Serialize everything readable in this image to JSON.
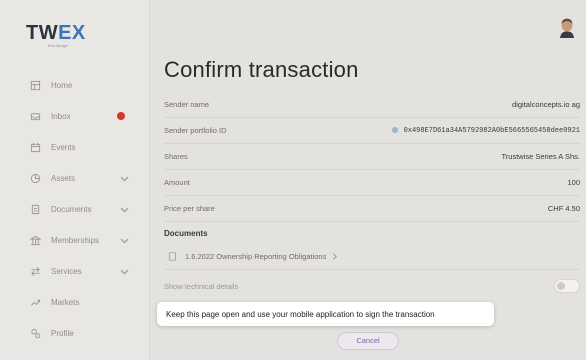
{
  "brand": {
    "logo_main": "TW",
    "logo_accent": "EX",
    "logo_sub": "Exchange"
  },
  "sidebar": {
    "items": [
      {
        "label": "Home",
        "icon": "home-icon"
      },
      {
        "label": "Inbox",
        "icon": "inbox-icon",
        "badge": true
      },
      {
        "label": "Events",
        "icon": "calendar-icon"
      },
      {
        "label": "Assets",
        "icon": "assets-icon",
        "chevron": true
      },
      {
        "label": "Documents",
        "icon": "documents-icon",
        "chevron": true
      },
      {
        "label": "Memberships",
        "icon": "memberships-icon",
        "chevron": true
      },
      {
        "label": "Services",
        "icon": "services-icon",
        "chevron": true
      },
      {
        "label": "Markets",
        "icon": "markets-icon"
      },
      {
        "label": "Profile",
        "icon": "profile-icon"
      }
    ]
  },
  "main": {
    "title": "Confirm transaction",
    "fields": [
      {
        "label": "Sender name",
        "value": "digitalconcepts.io ag"
      },
      {
        "label": "Sender portfolio ID",
        "value": "0x498E7D61a34A5792982A0bE5665565458dee0921"
      },
      {
        "label": "Shares",
        "value": "Trustwise Series A Shs."
      },
      {
        "label": "Amount",
        "value": "100"
      },
      {
        "label": "Price per share",
        "value": "CHF 4.50"
      }
    ],
    "documents_title": "Documents",
    "document_item": "1.6.2022 Ownership Reporting Obligations",
    "technical_label": "Show technical details",
    "toast": "Keep this page open and use your mobile application to sign the transaction",
    "cancel_label": "Cancel"
  },
  "colors": {
    "accent": "#3c74b8",
    "badge": "#d6362e",
    "cancel_text": "#8a5fb0"
  }
}
